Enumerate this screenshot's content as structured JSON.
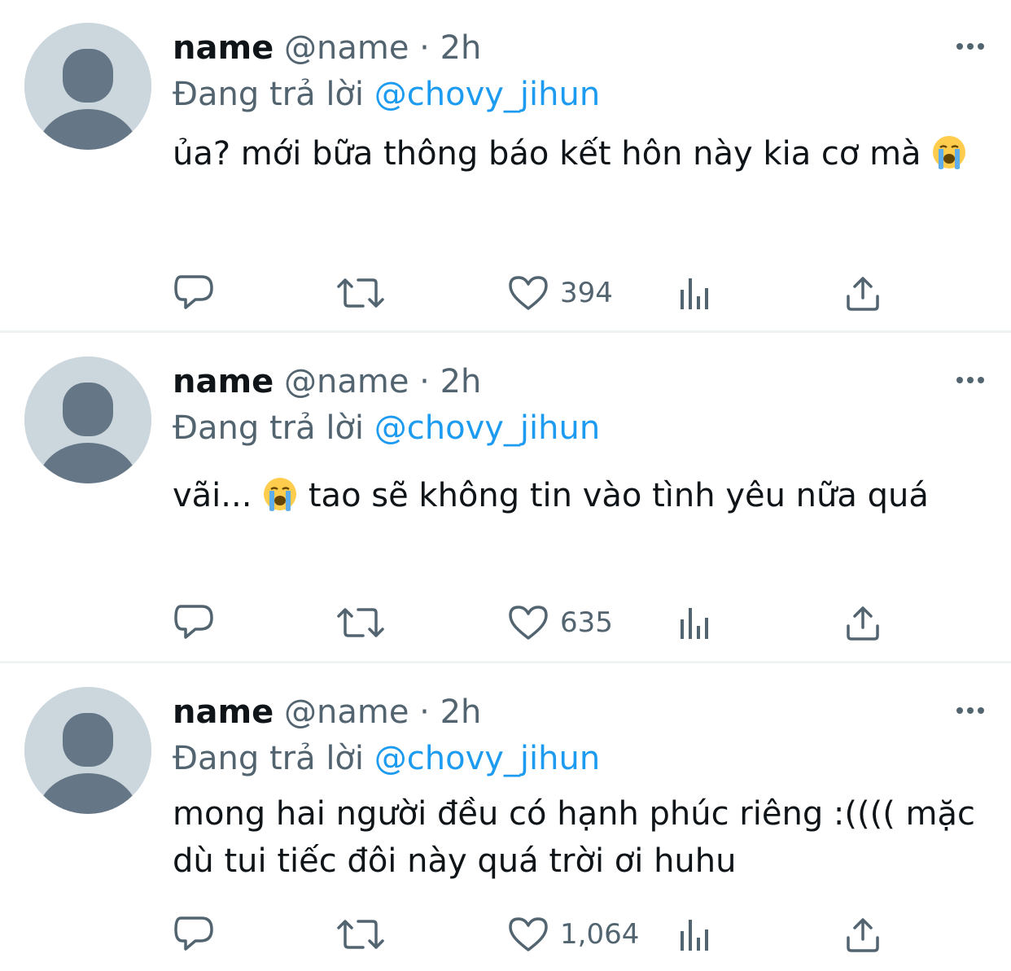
{
  "theme": {
    "text_color": "#0f1419",
    "secondary_color": "#536471",
    "mention_color": "#1d9bf0",
    "avatar_bg": "#ccd6dd",
    "avatar_fg": "#657786"
  },
  "tweets": [
    {
      "display_name": "name",
      "handle": "@name",
      "separator": "·",
      "time": "2h",
      "reply_prefix": "Đang trả lời",
      "reply_to": "@chovy_jihun",
      "text_before_emoji": "ủa? mới bữa thông báo kết hôn này kia cơ mà ",
      "text_after_emoji": "",
      "emoji": "loudly-crying-face",
      "like_count": "394"
    },
    {
      "display_name": "name",
      "handle": "@name",
      "separator": "·",
      "time": "2h",
      "reply_prefix": "Đang trả lời",
      "reply_to": "@chovy_jihun",
      "text_before_emoji": "vãi... ",
      "text_after_emoji": "  tao sẽ không tin vào tình yêu nữa quá",
      "emoji": "loudly-crying-face",
      "like_count": "635"
    },
    {
      "display_name": "name",
      "handle": "@name",
      "separator": "·",
      "time": "2h",
      "reply_prefix": "Đang trả lời",
      "reply_to": "@chovy_jihun",
      "text_before_emoji": "mong hai người đều có hạnh phúc riêng :(((( mặc dù tui tiếc đôi này quá trời ơi huhu",
      "text_after_emoji": "",
      "emoji": "",
      "like_count": "1,064"
    }
  ],
  "icons": {
    "more": "more-dots-icon",
    "reply": "reply-bubble-icon",
    "retweet": "retweet-icon",
    "like": "heart-icon",
    "views": "views-chart-icon",
    "share": "share-icon"
  }
}
